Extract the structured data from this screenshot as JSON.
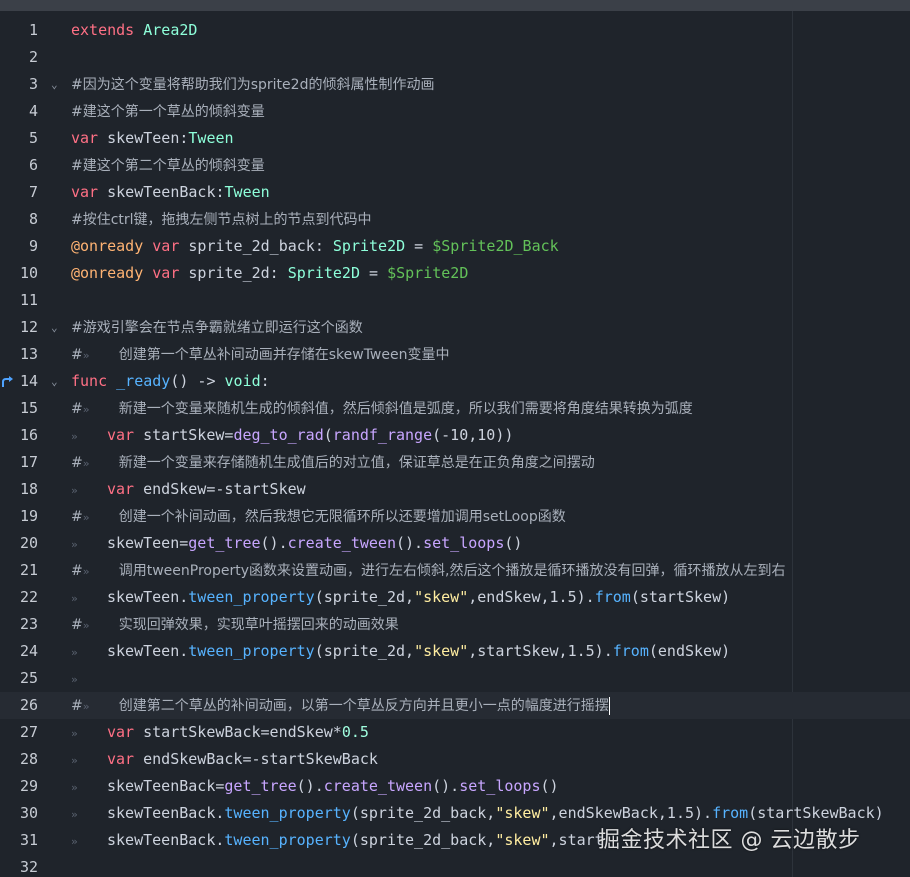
{
  "editor": {
    "current_line": 26,
    "lines": [
      {
        "n": "1",
        "fold": "",
        "tokens": [
          {
            "t": "extends ",
            "c": "kw"
          },
          {
            "t": "Area2D",
            "c": "cls"
          }
        ]
      },
      {
        "n": "2",
        "fold": "",
        "tokens": []
      },
      {
        "n": "3",
        "fold": "⌄",
        "tokens": [
          {
            "t": "#因为这个变量将帮助我们为sprite2d的倾斜属性制作动画",
            "c": "cm"
          }
        ]
      },
      {
        "n": "4",
        "fold": "",
        "tokens": [
          {
            "t": "#建这个第一个草丛的倾斜变量",
            "c": "cm"
          }
        ]
      },
      {
        "n": "5",
        "fold": "",
        "tokens": [
          {
            "t": "var ",
            "c": "kw"
          },
          {
            "t": "skewTeen:",
            "c": "plain"
          },
          {
            "t": "Tween",
            "c": "cls"
          }
        ]
      },
      {
        "n": "6",
        "fold": "",
        "tokens": [
          {
            "t": "#建这个第二个草丛的倾斜变量",
            "c": "cm"
          }
        ]
      },
      {
        "n": "7",
        "fold": "",
        "tokens": [
          {
            "t": "var ",
            "c": "kw"
          },
          {
            "t": "skewTeenBack:",
            "c": "plain"
          },
          {
            "t": "Tween",
            "c": "cls"
          }
        ]
      },
      {
        "n": "8",
        "fold": "",
        "tokens": [
          {
            "t": "#按住ctrl键，拖拽左侧节点树上的节点到代码中",
            "c": "cm"
          }
        ]
      },
      {
        "n": "9",
        "fold": "",
        "tokens": [
          {
            "t": "@onready ",
            "c": "ann"
          },
          {
            "t": "var ",
            "c": "kw"
          },
          {
            "t": "sprite_2d_back: ",
            "c": "plain"
          },
          {
            "t": "Sprite2D",
            "c": "cls"
          },
          {
            "t": " = ",
            "c": "plain"
          },
          {
            "t": "$Sprite2D_Back",
            "c": "node"
          }
        ]
      },
      {
        "n": "10",
        "fold": "",
        "tokens": [
          {
            "t": "@onready ",
            "c": "ann"
          },
          {
            "t": "var ",
            "c": "kw"
          },
          {
            "t": "sprite_2d: ",
            "c": "plain"
          },
          {
            "t": "Sprite2D",
            "c": "cls"
          },
          {
            "t": " = ",
            "c": "plain"
          },
          {
            "t": "$Sprite2D",
            "c": "node"
          }
        ]
      },
      {
        "n": "11",
        "fold": "",
        "tokens": []
      },
      {
        "n": "12",
        "fold": "⌄",
        "tokens": [
          {
            "t": "#游戏引擎会在节点争霸就绪立即运行这个函数",
            "c": "cm"
          }
        ]
      },
      {
        "n": "13",
        "fold": "",
        "tokens": [
          {
            "t": "#",
            "c": "cm"
          },
          {
            "t": "TAB",
            "c": "tab"
          },
          {
            "t": "创建第一个草丛补间动画并存储在skewTween变量中",
            "c": "cm"
          }
        ]
      },
      {
        "n": "14",
        "fold": "⌄",
        "bp": true,
        "tokens": [
          {
            "t": "func ",
            "c": "kw"
          },
          {
            "t": "_ready",
            "c": "fn"
          },
          {
            "t": "() -> ",
            "c": "plain"
          },
          {
            "t": "void",
            "c": "cls"
          },
          {
            "t": ":",
            "c": "plain"
          }
        ]
      },
      {
        "n": "15",
        "fold": "",
        "tokens": [
          {
            "t": "#",
            "c": "cm"
          },
          {
            "t": "TAB",
            "c": "tab"
          },
          {
            "t": "新建一个变量来随机生成的倾斜值，然后倾斜值是弧度，所以我们需要将角度结果转换为弧度",
            "c": "cm"
          }
        ]
      },
      {
        "n": "16",
        "fold": "",
        "tokens": [
          {
            "t": "TAB",
            "c": "tab"
          },
          {
            "t": "var ",
            "c": "kw"
          },
          {
            "t": "startSkew=",
            "c": "plain"
          },
          {
            "t": "deg_to_rad",
            "c": "call"
          },
          {
            "t": "(",
            "c": "plain"
          },
          {
            "t": "randf_range",
            "c": "call"
          },
          {
            "t": "(-10,10))",
            "c": "plain"
          }
        ]
      },
      {
        "n": "17",
        "fold": "",
        "tokens": [
          {
            "t": "#",
            "c": "cm"
          },
          {
            "t": "TAB",
            "c": "tab"
          },
          {
            "t": "新建一个变量来存储随机生成值后的对立值，保证草总是在正负角度之间摆动",
            "c": "cm"
          }
        ]
      },
      {
        "n": "18",
        "fold": "",
        "tokens": [
          {
            "t": "TAB",
            "c": "tab"
          },
          {
            "t": "var ",
            "c": "kw"
          },
          {
            "t": "endSkew=-startSkew",
            "c": "plain"
          }
        ]
      },
      {
        "n": "19",
        "fold": "",
        "tokens": [
          {
            "t": "#",
            "c": "cm"
          },
          {
            "t": "TAB",
            "c": "tab"
          },
          {
            "t": "创建一个补间动画，然后我想它无限循环所以还要增加调用setLoop函数",
            "c": "cm"
          }
        ]
      },
      {
        "n": "20",
        "fold": "",
        "tokens": [
          {
            "t": "TAB",
            "c": "tab"
          },
          {
            "t": "skewTeen=",
            "c": "plain"
          },
          {
            "t": "get_tree",
            "c": "call"
          },
          {
            "t": "().",
            "c": "plain"
          },
          {
            "t": "create_tween",
            "c": "call"
          },
          {
            "t": "().",
            "c": "plain"
          },
          {
            "t": "set_loops",
            "c": "call"
          },
          {
            "t": "()",
            "c": "plain"
          }
        ]
      },
      {
        "n": "21",
        "fold": "",
        "tokens": [
          {
            "t": "#",
            "c": "cm"
          },
          {
            "t": "TAB",
            "c": "tab"
          },
          {
            "t": "调用tweenProperty函数来设置动画，进行左右倾斜,然后这个播放是循环播放没有回弹，循环播放从左到右",
            "c": "cm"
          }
        ]
      },
      {
        "n": "22",
        "fold": "",
        "tokens": [
          {
            "t": "TAB",
            "c": "tab"
          },
          {
            "t": "skewTeen.",
            "c": "plain"
          },
          {
            "t": "tween_property",
            "c": "fn"
          },
          {
            "t": "(sprite_2d,",
            "c": "plain"
          },
          {
            "t": "\"skew\"",
            "c": "str"
          },
          {
            "t": ",endSkew,1.5).",
            "c": "plain"
          },
          {
            "t": "from",
            "c": "fn"
          },
          {
            "t": "(startSkew)",
            "c": "plain"
          }
        ]
      },
      {
        "n": "23",
        "fold": "",
        "tokens": [
          {
            "t": "#",
            "c": "cm"
          },
          {
            "t": "TAB",
            "c": "tab"
          },
          {
            "t": "实现回弹效果，实现草叶摇摆回来的动画效果",
            "c": "cm"
          }
        ]
      },
      {
        "n": "24",
        "fold": "",
        "tokens": [
          {
            "t": "TAB",
            "c": "tab"
          },
          {
            "t": "skewTeen.",
            "c": "plain"
          },
          {
            "t": "tween_property",
            "c": "fn"
          },
          {
            "t": "(sprite_2d,",
            "c": "plain"
          },
          {
            "t": "\"skew\"",
            "c": "str"
          },
          {
            "t": ",startSkew,1.5).",
            "c": "plain"
          },
          {
            "t": "from",
            "c": "fn"
          },
          {
            "t": "(endSkew)",
            "c": "plain"
          }
        ]
      },
      {
        "n": "25",
        "fold": "",
        "tokens": [
          {
            "t": "TAB",
            "c": "tab"
          }
        ]
      },
      {
        "n": "26",
        "fold": "",
        "tokens": [
          {
            "t": "#",
            "c": "cm"
          },
          {
            "t": "TAB",
            "c": "tab"
          },
          {
            "t": "创建第二个草丛的补间动画，以第一个草丛反方向并且更小一点的幅度进行摇摆",
            "c": "cm"
          },
          {
            "t": "CARET",
            "c": "caret"
          }
        ]
      },
      {
        "n": "27",
        "fold": "",
        "tokens": [
          {
            "t": "TAB",
            "c": "tab"
          },
          {
            "t": "var ",
            "c": "kw"
          },
          {
            "t": "startSkewBack=endSkew*",
            "c": "plain"
          },
          {
            "t": "0.5",
            "c": "num"
          }
        ]
      },
      {
        "n": "28",
        "fold": "",
        "tokens": [
          {
            "t": "TAB",
            "c": "tab"
          },
          {
            "t": "var ",
            "c": "kw"
          },
          {
            "t": "endSkewBack=-startSkewBack",
            "c": "plain"
          }
        ]
      },
      {
        "n": "29",
        "fold": "",
        "tokens": [
          {
            "t": "TAB",
            "c": "tab"
          },
          {
            "t": "skewTeenBack=",
            "c": "plain"
          },
          {
            "t": "get_tree",
            "c": "call"
          },
          {
            "t": "().",
            "c": "plain"
          },
          {
            "t": "create_tween",
            "c": "call"
          },
          {
            "t": "().",
            "c": "plain"
          },
          {
            "t": "set_loops",
            "c": "call"
          },
          {
            "t": "()",
            "c": "plain"
          }
        ]
      },
      {
        "n": "30",
        "fold": "",
        "tokens": [
          {
            "t": "TAB",
            "c": "tab"
          },
          {
            "t": "skewTeenBack.",
            "c": "plain"
          },
          {
            "t": "tween_property",
            "c": "fn"
          },
          {
            "t": "(sprite_2d_back,",
            "c": "plain"
          },
          {
            "t": "\"skew\"",
            "c": "str"
          },
          {
            "t": ",endSkewBack,1.5).",
            "c": "plain"
          },
          {
            "t": "from",
            "c": "fn"
          },
          {
            "t": "(startSkewBack)",
            "c": "plain"
          }
        ]
      },
      {
        "n": "31",
        "fold": "",
        "tokens": [
          {
            "t": "TAB",
            "c": "tab"
          },
          {
            "t": "skewTeenBack.",
            "c": "plain"
          },
          {
            "t": "tween_property",
            "c": "fn"
          },
          {
            "t": "(sprite_2d_back,",
            "c": "plain"
          },
          {
            "t": "\"skew\"",
            "c": "str"
          },
          {
            "t": ",start",
            "c": "plain"
          }
        ]
      },
      {
        "n": "32",
        "fold": "",
        "tokens": []
      }
    ]
  },
  "watermark": "掘金技术社区 @ 云边散步",
  "colors": {
    "keyword": "#ff7085",
    "class": "#8effda",
    "comment": "#a9b0bb",
    "annotation": "#ffb373",
    "node_path": "#63c259",
    "function": "#57b3ff",
    "call": "#c8a6ff",
    "string": "#ffeda1",
    "number": "#a1ffe0"
  }
}
